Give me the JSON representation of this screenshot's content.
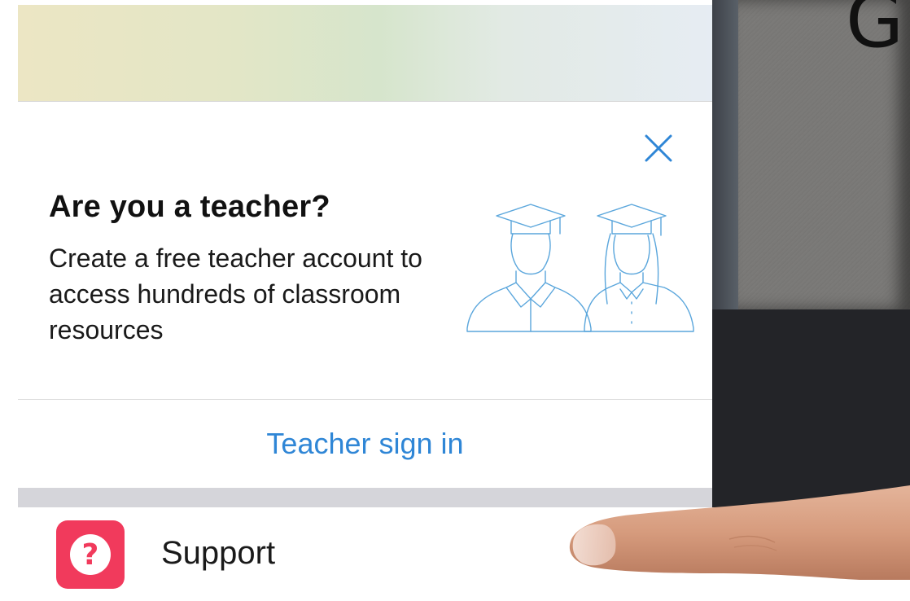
{
  "teacher_card": {
    "title": "Are you a teacher?",
    "body": "Create a free teacher account to access hundreds of classroom resources",
    "signin_label": "Teacher sign in",
    "close_icon": "close-icon",
    "illustration": "graduates-icon"
  },
  "menu": {
    "items": [
      {
        "label": "Support",
        "icon": "help-question-icon",
        "icon_color": "#f13a5c"
      }
    ]
  },
  "background_app": {
    "partial_glyph": "G"
  },
  "colors": {
    "accent": "#2f86d6",
    "support_icon": "#f13a5c",
    "title": "#111111",
    "separator": "#d5d5da"
  }
}
